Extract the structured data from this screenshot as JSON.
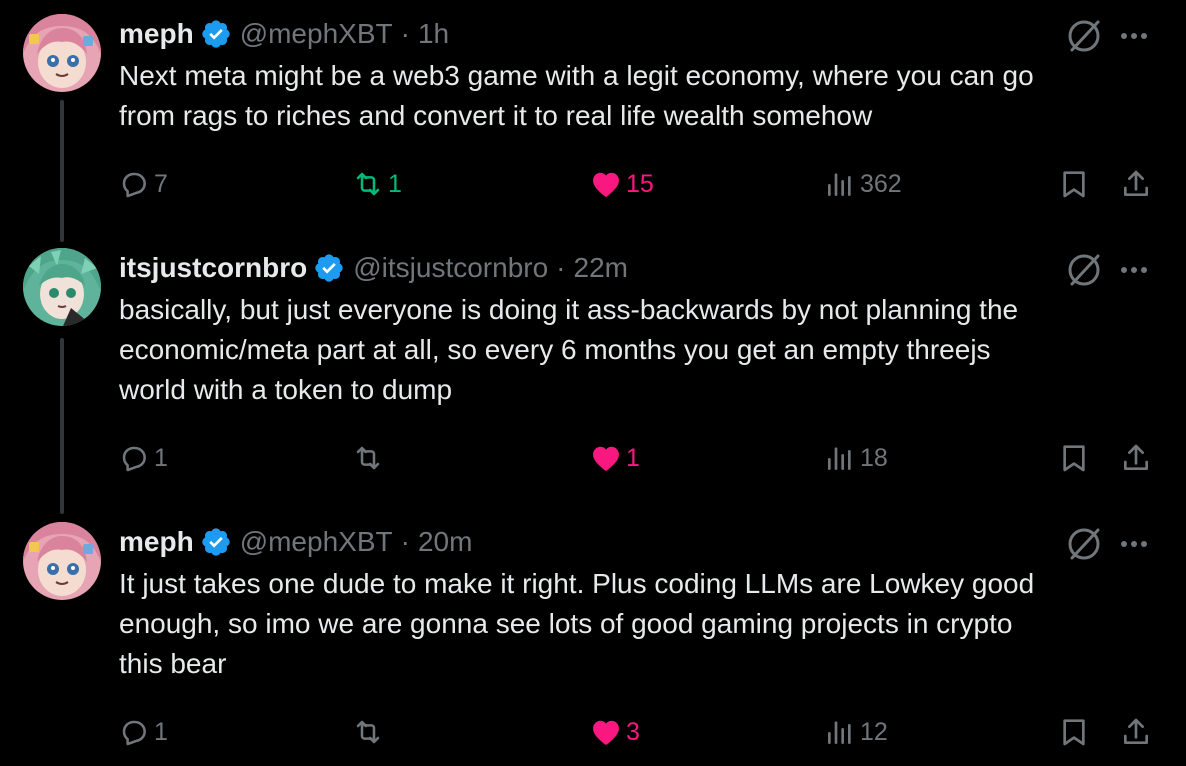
{
  "colors": {
    "background": "#000000",
    "text": "#e7e9ea",
    "muted": "#71767b",
    "verified": "#1d9bf0",
    "retweet_active": "#00ba7c",
    "like_active": "#f91880"
  },
  "tweets": [
    {
      "name": "meph",
      "handle": "@mephXBT",
      "separator": "·",
      "time": "1h",
      "text": "Next meta might be a web3 game with a legit economy, where you can go\nfrom rags to riches and convert it to real life wealth somehow",
      "replies": "7",
      "retweets": "1",
      "likes": "15",
      "views": "362",
      "retweeted": true,
      "liked": true
    },
    {
      "name": "itsjustcornbro",
      "handle": "@itsjustcornbro",
      "separator": "·",
      "time": "22m",
      "text": "basically, but just everyone is doing it ass-backwards by not planning the\neconomic/meta part at all, so every 6 months you get an empty threejs\nworld with a token to dump",
      "replies": "1",
      "retweets": "",
      "likes": "1",
      "views": "18",
      "retweeted": false,
      "liked": true
    },
    {
      "name": "meph",
      "handle": "@mephXBT",
      "separator": "·",
      "time": "20m",
      "text": "It just takes one dude to make it right. Plus coding LLMs are Lowkey good\nenough, so imo we are gonna see lots of good gaming projects in crypto\nthis bear",
      "replies": "1",
      "retweets": "",
      "likes": "3",
      "views": "12",
      "retweeted": false,
      "liked": true
    }
  ],
  "icons": {
    "verified": "verified-badge-icon",
    "grok": "grok-icon",
    "more": "more-icon",
    "reply": "reply-icon",
    "retweet": "retweet-icon",
    "like": "heart-icon",
    "views": "views-icon",
    "bookmark": "bookmark-icon",
    "share": "share-icon"
  }
}
